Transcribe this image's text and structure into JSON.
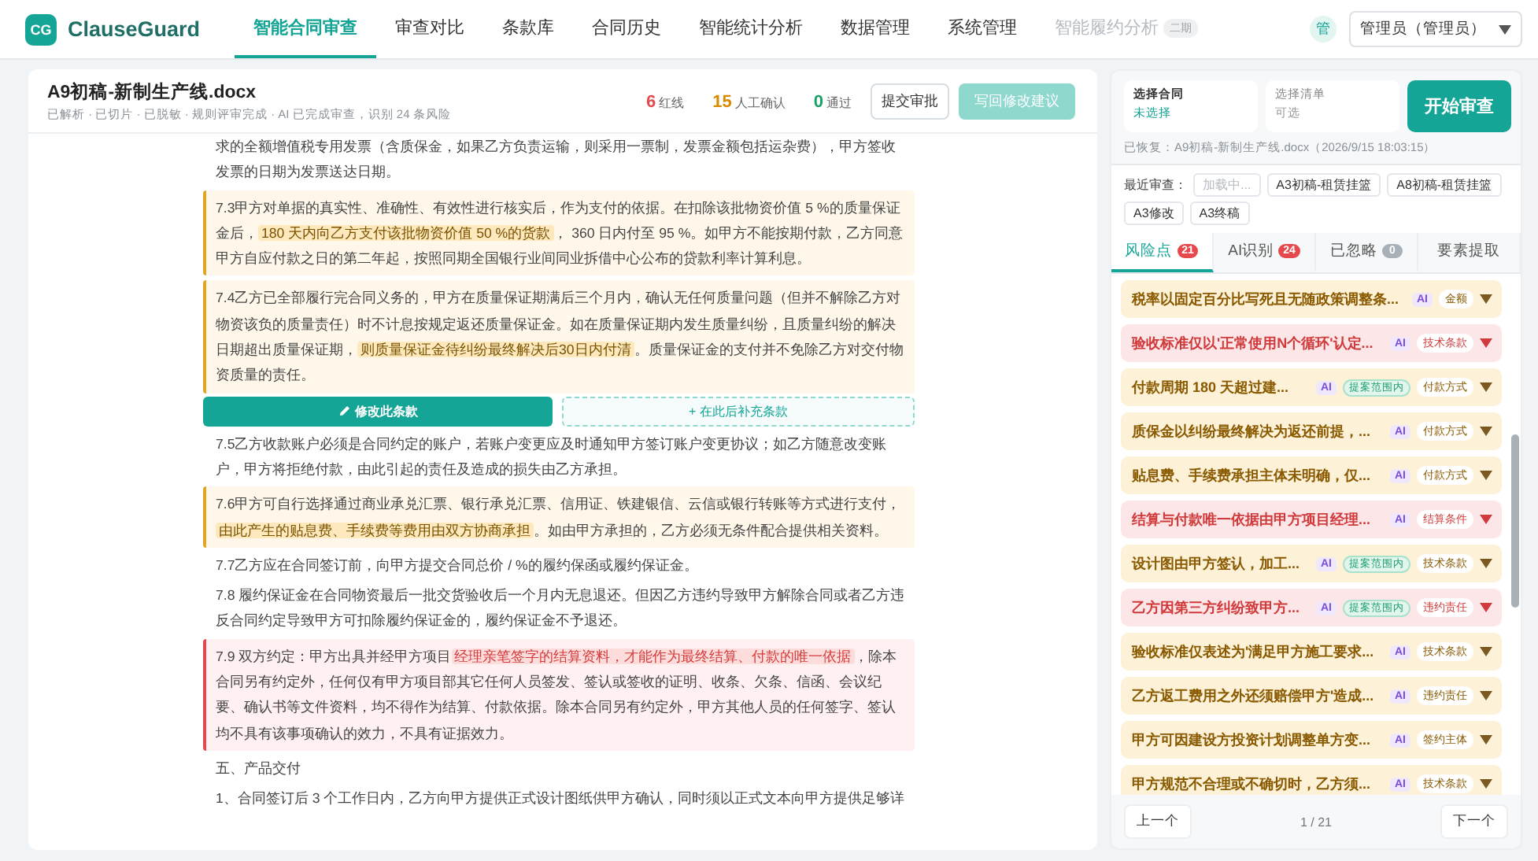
{
  "nav": {
    "logo_mark": "CG",
    "brand": "ClauseGuard",
    "items": [
      {
        "label": "智能合同审查",
        "selected": true,
        "disabled": false
      },
      {
        "label": "审查对比",
        "selected": false,
        "disabled": false
      },
      {
        "label": "条款库",
        "selected": false,
        "disabled": false
      },
      {
        "label": "合同历史",
        "selected": false,
        "disabled": false
      },
      {
        "label": "智能统计分析",
        "selected": false,
        "disabled": false
      },
      {
        "label": "数据管理",
        "selected": false,
        "disabled": false
      },
      {
        "label": "系统管理",
        "selected": false,
        "disabled": false
      },
      {
        "label": "智能履约分析",
        "selected": false,
        "disabled": true,
        "badge": "二期"
      }
    ],
    "avatar": "管",
    "user_select": "管理员（管理员）"
  },
  "document": {
    "title": "A9初稿-新制生产线.docx",
    "status": "已解析 · 已切片 · 已脱敏 · 规则评审完成 · AI 已完成审查，识别 24 条风险",
    "stats": [
      {
        "value": "6",
        "label": "红线",
        "color": "#e5484d"
      },
      {
        "value": "15",
        "label": "人工确认",
        "color": "#d98a00"
      },
      {
        "value": "0",
        "label": "通过",
        "color": "#1a9e6a"
      }
    ],
    "buttons": [
      {
        "label": "提交审批",
        "kind": "outline"
      },
      {
        "label": "写回修改建议",
        "kind": "primary-disabled"
      }
    ],
    "paragraphs": [
      {
        "kind": "plain",
        "segments": [
          {
            "text": "求的全额增值税专用发票（含质保金，如果乙方负责运输，则采用一票制，发票金额包括运杂费），甲方签收发票的日期为发票送达日期。",
            "highlight": false
          }
        ]
      },
      {
        "kind": "warning",
        "segments": [
          {
            "text": "7.3甲方对单据的真实性、准确性、有效性进行核实后，作为支付的依据。在扣除该批物资价值 5 %的质量保证金后，",
            "highlight": false
          },
          {
            "text": "180 天内向乙方支付该批物资价值 50 %的货款",
            "highlight": true
          },
          {
            "text": "， 360 日内付至 95 %。如甲方不能按期付款，乙方同意甲方自应付款之日的第二年起，按照同期全国银行业间同业拆借中心公布的贷款利率计算利息。",
            "highlight": false
          }
        ]
      },
      {
        "kind": "warning",
        "segments": [
          {
            "text": "7.4乙方已全部履行完合同义务的，甲方在质量保证期满后三个月内，确认无任何质量问题（但并不解除乙方对物资该负的质量责任）时不计息按规定返还质量保证金。如在质量保证期内发生质量纠纷，且质量纠纷的解决日期超出质量保证期，",
            "highlight": false
          },
          {
            "text": "则质量保证金待纠纷最终解决后30日内付清",
            "highlight": true
          },
          {
            "text": "。质量保证金的支付并不免除乙方对交付物资质量的责任。",
            "highlight": false
          }
        ]
      },
      {
        "kind": "actions",
        "buttons": [
          {
            "label": "修改此条款",
            "kind": "primary"
          },
          {
            "label": "+ 在此后补充条款",
            "kind": "dashed"
          }
        ]
      },
      {
        "kind": "plain",
        "segments": [
          {
            "text": "7.5乙方收款账户必须是合同约定的账户，若账户变更应及时通知甲方签订账户变更协议；如乙方随意改变账户，甲方将拒绝付款，由此引起的责任及造成的损失由乙方承担。",
            "highlight": false
          }
        ]
      },
      {
        "kind": "warning",
        "segments": [
          {
            "text": "7.6甲方可自行选择通过商业承兑汇票、银行承兑汇票、信用证、铁建银信、云信或银行转账等方式进行支付，",
            "highlight": false
          },
          {
            "text": "由此产生的贴息费、手续费等费用由双方协商承担",
            "highlight": true
          },
          {
            "text": "。如由甲方承担的，乙方必须无条件配合提供相关资料。",
            "highlight": false
          }
        ]
      },
      {
        "kind": "plain",
        "segments": [
          {
            "text": "7.7乙方应在合同签订前，向甲方提交合同总价 / %的履约保函或履约保证金。",
            "highlight": false
          }
        ]
      },
      {
        "kind": "plain",
        "segments": [
          {
            "text": "7.8 履约保证金在合同物资最后一批交货验收后一个月内无息退还。但因乙方违约导致甲方解除合同或者乙方违反合同约定导致甲方可扣除履约保证金的，履约保证金不予退还。",
            "highlight": false
          }
        ]
      },
      {
        "kind": "danger",
        "segments": [
          {
            "text": "7.9 双方约定：甲方出具并经甲方项目",
            "highlight": false
          },
          {
            "text": "经理亲笔签字的结算资料，才能作为最终结算、付款的唯一依据",
            "highlight": true
          },
          {
            "text": "，除本合同另有约定外，任何仅有甲方项目部其它任何人员签发、签认或签收的证明、收条、欠条、信函、会议纪要、确认书等文件资料，均不得作为结算、付款依据。除本合同另有约定外，甲方其他人员的任何签字、签认均不具有该事项确认的效力，不具有证据效力。",
            "highlight": false
          }
        ]
      },
      {
        "kind": "plain",
        "segments": [
          {
            "text": "五、产品交付",
            "highlight": false
          }
        ]
      },
      {
        "kind": "plain",
        "segments": [
          {
            "text": "1、合同签订后 3 个工作日内，乙方向甲方提供正式设计图纸供甲方确认，同时须以正式文本向甲方提供足够详",
            "highlight": false
          }
        ]
      }
    ]
  },
  "panel": {
    "selectors": [
      {
        "label": "选择合同",
        "value": "未选择",
        "kind": "required"
      },
      {
        "label": "选择清单",
        "value": "可选",
        "kind": "optional"
      }
    ],
    "start_button": "开始审查",
    "restored": "已恢复：A9初稿-新制生产线.docx（2026/9/15 18:03:15）",
    "recent_label": "最近审查：",
    "recent": [
      {
        "label": "加载中...",
        "disabled": true
      },
      {
        "label": "A3初稿-租赁挂篮",
        "disabled": false
      },
      {
        "label": "A8初稿-租赁挂篮",
        "disabled": false
      },
      {
        "label": "A3修改",
        "disabled": false
      },
      {
        "label": "A3终稿",
        "disabled": false
      }
    ],
    "tabs": [
      {
        "label": "风险点",
        "count": "21",
        "color": "#e5484d",
        "selected": true
      },
      {
        "label": "AI识别",
        "count": "24",
        "color": "#e5484d",
        "selected": false
      },
      {
        "label": "已忽略",
        "count": "0",
        "color": "#a8b0b8",
        "selected": false
      },
      {
        "label": "要素提取",
        "selected": false
      }
    ],
    "risks": [
      {
        "text": "税率以固定百分比写死且无随政策调整条...",
        "ai": "AI",
        "category": "金额",
        "kind": "medium"
      },
      {
        "text": "验收标准仅以'正常使用N个循环'认定...",
        "ai": "AI",
        "category": "技术条款",
        "kind": "high"
      },
      {
        "text": "付款周期 180 天超过建...",
        "ai": "AI",
        "scope": "提案范围内",
        "category": "付款方式",
        "kind": "medium"
      },
      {
        "text": "质保金以纠纷最终解决为返还前提，...",
        "ai": "AI",
        "category": "付款方式",
        "kind": "medium"
      },
      {
        "text": "贴息费、手续费承担主体未明确，仅...",
        "ai": "AI",
        "category": "付款方式",
        "kind": "medium"
      },
      {
        "text": "结算与付款唯一依据由甲方项目经理...",
        "ai": "AI",
        "category": "结算条件",
        "kind": "high"
      },
      {
        "text": "设计图由甲方签认，加工...",
        "ai": "AI",
        "scope": "提案范围内",
        "category": "技术条款",
        "kind": "medium"
      },
      {
        "text": "乙方因第三方纠纷致甲方...",
        "ai": "AI",
        "scope": "提案范围内",
        "category": "违约责任",
        "kind": "high"
      },
      {
        "text": "验收标准仅表述为'满足甲方施工要求...",
        "ai": "AI",
        "category": "技术条款",
        "kind": "medium"
      },
      {
        "text": "乙方返工费用之外还须赔偿甲方'造成...",
        "ai": "AI",
        "category": "违约责任",
        "kind": "medium"
      },
      {
        "text": "甲方可因建设方投资计划调整单方变...",
        "ai": "AI",
        "category": "签约主体",
        "kind": "medium"
      },
      {
        "text": "甲方规范不合理或不确切时，乙方须...",
        "ai": "AI",
        "category": "技术条款",
        "kind": "medium"
      }
    ],
    "pager": {
      "prev": "上一个",
      "position": "1 / 21",
      "next": "下一个"
    }
  }
}
